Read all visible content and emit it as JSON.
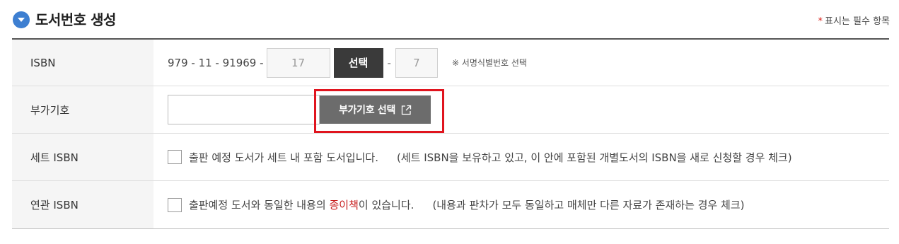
{
  "section": {
    "title": "도서번호 생성",
    "required_star": "*",
    "required_note": "표시는 필수 항목"
  },
  "rows": {
    "isbn": {
      "label": "ISBN",
      "prefix": "979 - 11 - 91969 -",
      "code_value": "17",
      "select_label": "선택",
      "separator": "-",
      "check_digit": "7",
      "note": "※ 서명식별번호 선택"
    },
    "addon": {
      "label": "부가기호",
      "input_value": "",
      "button_label": "부가기호 선택"
    },
    "set_isbn": {
      "label": "세트 ISBN",
      "checked": false,
      "text": "출판 예정 도서가 세트 내 포함 도서입니다.",
      "hint": "(세트 ISBN을 보유하고 있고, 이 안에 포함된 개별도서의 ISBN을 새로 신청할 경우 체크)"
    },
    "related_isbn": {
      "label": "연관 ISBN",
      "checked": false,
      "text_before": "출판예정 도서와 동일한 내용의 ",
      "text_highlight": "종이책",
      "text_after": "이 있습니다.",
      "hint": "(내용과 판차가 모두 동일하고 매체만 다른 자료가 존재하는 경우 체크)"
    }
  },
  "colors": {
    "accent_blue": "#3d7fd1",
    "highlight_red": "#e0141e",
    "dark_button": "#3a3a3a",
    "addon_button": "#6c6c6c"
  }
}
